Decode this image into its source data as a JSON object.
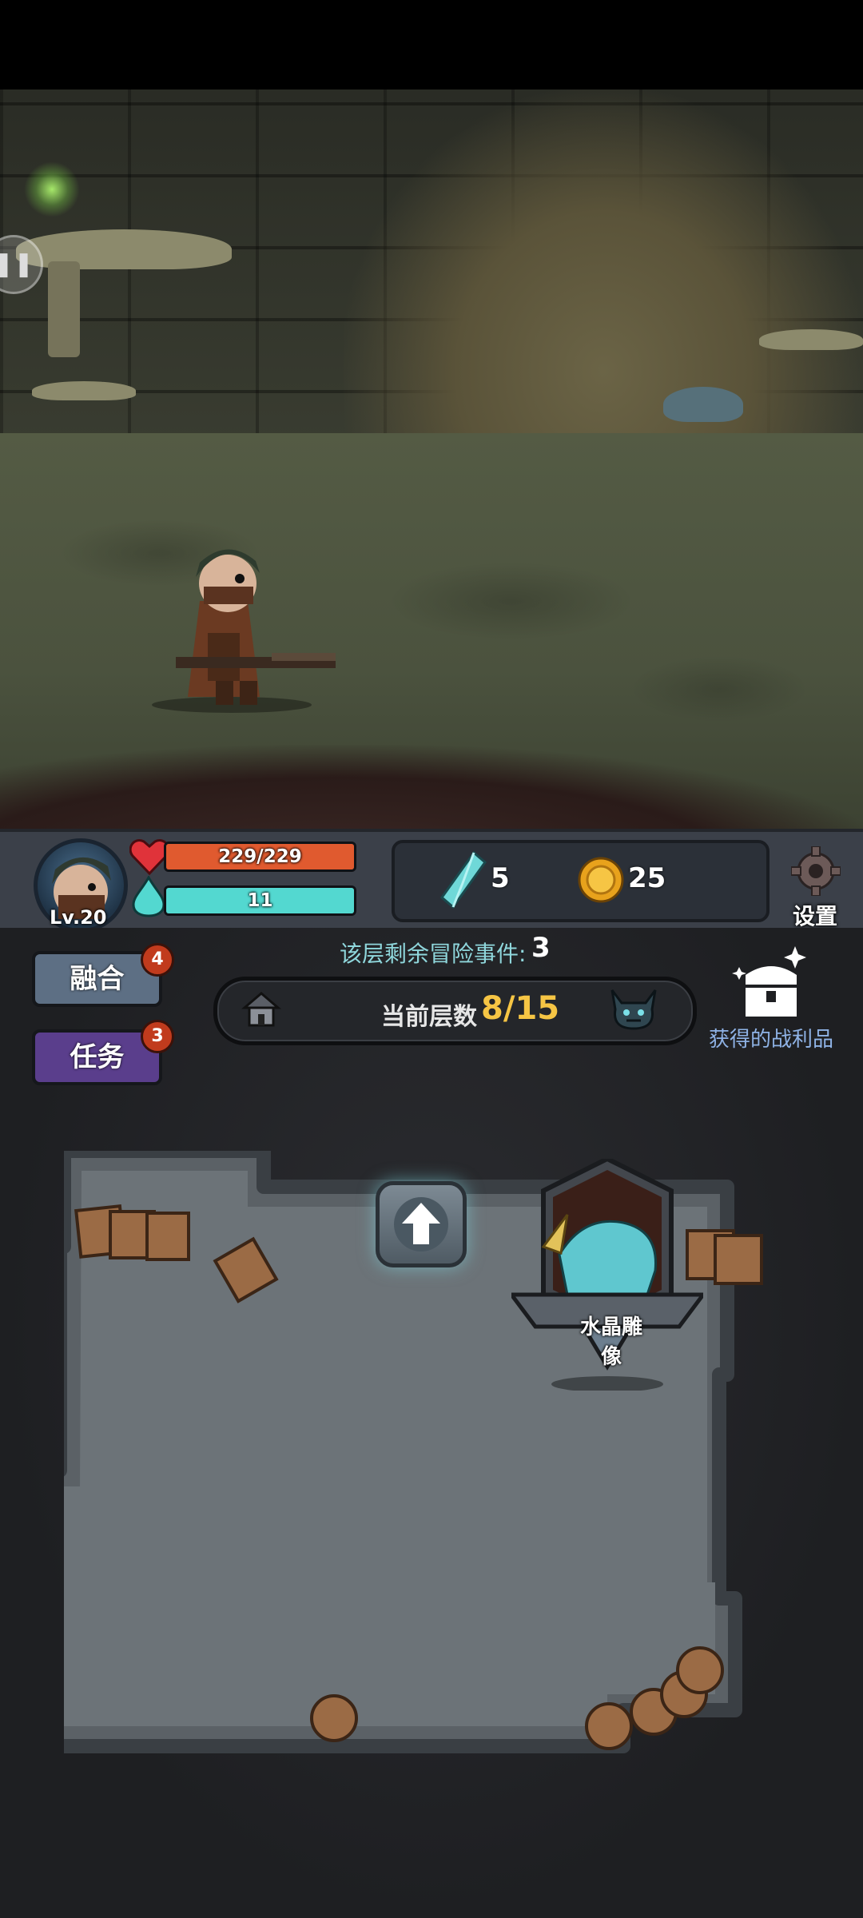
{
  "player": {
    "level": "Lv.20",
    "hp_text": "229/229",
    "hp_fraction": 1.0,
    "mp_text": "11",
    "mp_fraction": 1.0
  },
  "currency": {
    "crystals": "5",
    "coins": "25"
  },
  "settings_label": "设置",
  "buttons": {
    "fuse": {
      "label": "融合",
      "badge": "4"
    },
    "quest": {
      "label": "任务",
      "badge": "3"
    }
  },
  "events": {
    "label": "该层剩余冒险事件:",
    "count": "3"
  },
  "floor": {
    "label": "当前层数",
    "value": "8/15"
  },
  "loot_label": "获得的战利品",
  "map": {
    "statue_label": "水晶雕像"
  },
  "colors": {
    "hp": "#e05a2f",
    "mp": "#53d8d0",
    "floor_value": "#f6c544",
    "events_label": "#8fd7dc",
    "loot_label": "#8fb3e6",
    "fuse_button": "#5d6f84",
    "quest_button": "#5a3e8c"
  },
  "icons": {
    "pause": "pause-icon",
    "heart": "heart-icon",
    "mana": "mana-drop-icon",
    "crystal": "crystal-icon",
    "coin": "coin-icon",
    "settings": "gear-icon",
    "home": "house-icon",
    "boss": "demon-head-icon",
    "loot": "treasure-chest-icon",
    "up": "up-arrow-icon"
  }
}
